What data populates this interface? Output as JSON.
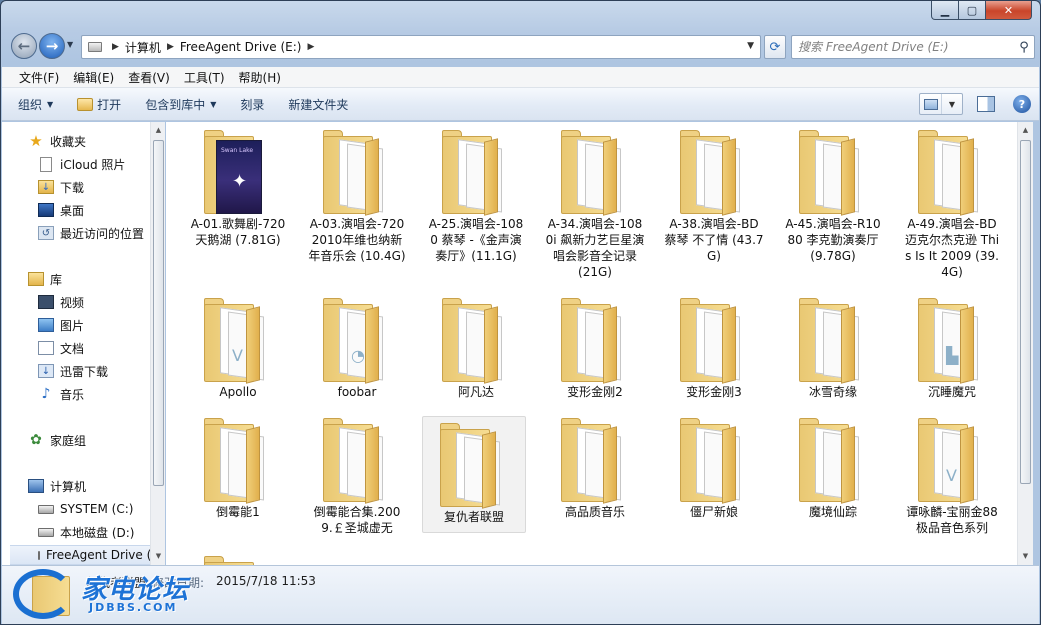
{
  "window": {
    "controls": {
      "minimize": "▁",
      "maximize": "▢",
      "close": "✕"
    }
  },
  "address": {
    "crumbs": [
      "计算机",
      "FreeAgent Drive (E:)"
    ]
  },
  "search": {
    "placeholder": "搜索 FreeAgent Drive (E:)"
  },
  "menubar": {
    "items": [
      "文件(F)",
      "编辑(E)",
      "查看(V)",
      "工具(T)",
      "帮助(H)"
    ]
  },
  "toolbar": {
    "organize": "组织",
    "open": "打开",
    "include_library": "包含到库中",
    "burn": "刻录",
    "new_folder": "新建文件夹"
  },
  "nav": {
    "favorites": "收藏夹",
    "icloud": "iCloud 照片",
    "downloads": "下载",
    "desktop": "桌面",
    "recent": "最近访问的位置",
    "libraries": "库",
    "videos": "视频",
    "pictures": "图片",
    "documents": "文档",
    "thunder": "迅雷下载",
    "music": "音乐",
    "homegroup": "家庭组",
    "computer": "计算机",
    "system_drive": "SYSTEM (C:)",
    "local_disk": "本地磁盘 (D:)",
    "freeagent": "FreeAgent Drive (E:)"
  },
  "files": [
    {
      "name": "A-01.歌舞剧-720 天鹅湖 (7.81G)",
      "icon": "swan-lake-cover"
    },
    {
      "name": "A-03.演唱会-720 2010年维也纳新年音乐会 (10.4G)",
      "icon": "folder-icon"
    },
    {
      "name": "A-25.演唱会-1080 蔡琴 -《金声演奏厅》(11.1G)",
      "icon": "folder-icon"
    },
    {
      "name": "A-34.演唱会-1080i 飙新力艺巨星演唱会影音全记录 (21G)",
      "icon": "folder-icon"
    },
    {
      "name": "A-38.演唱会-BD 蔡琴 不了情 (43.7G)",
      "icon": "folder-icon"
    },
    {
      "name": "A-45.演唱会-R1080 李克勤演奏厅 (9.78G)",
      "icon": "folder-icon"
    },
    {
      "name": "A-49.演唱会-BD 迈克尔杰克逊 This Is It 2009 (39.4G)",
      "icon": "folder-icon"
    },
    {
      "name": "Apollo",
      "icon": "folder-icon"
    },
    {
      "name": "foobar",
      "icon": "folder-icon"
    },
    {
      "name": "阿凡达",
      "icon": "folder-icon"
    },
    {
      "name": "变形金刚2",
      "icon": "folder-icon"
    },
    {
      "name": "变形金刚3",
      "icon": "folder-icon"
    },
    {
      "name": "冰雪奇缘",
      "icon": "folder-icon"
    },
    {
      "name": "沉睡魔咒",
      "icon": "folder-icon"
    },
    {
      "name": "倒霉能1",
      "icon": "folder-icon"
    },
    {
      "name": "倒霉能合集.2009.￡圣城虚无",
      "icon": "folder-icon"
    },
    {
      "name": "复仇者联盟",
      "icon": "folder-icon"
    },
    {
      "name": "高品质音乐",
      "icon": "folder-icon"
    },
    {
      "name": "僵尸新娘",
      "icon": "folder-icon"
    },
    {
      "name": "魔境仙踪",
      "icon": "folder-icon"
    },
    {
      "name": "谭咏麟-宝丽金88极品音色系列",
      "icon": "folder-icon"
    }
  ],
  "details": {
    "name": "复仇者联盟",
    "date_label": "修改日期:",
    "date": "2015/7/18 11:53"
  },
  "watermark": {
    "title": "家电论坛",
    "subtitle": "JDBBS.COM"
  },
  "colors": {
    "accent": "#1e73d6",
    "folder": "#f0cf7a",
    "selection": "#f2f2f2"
  }
}
